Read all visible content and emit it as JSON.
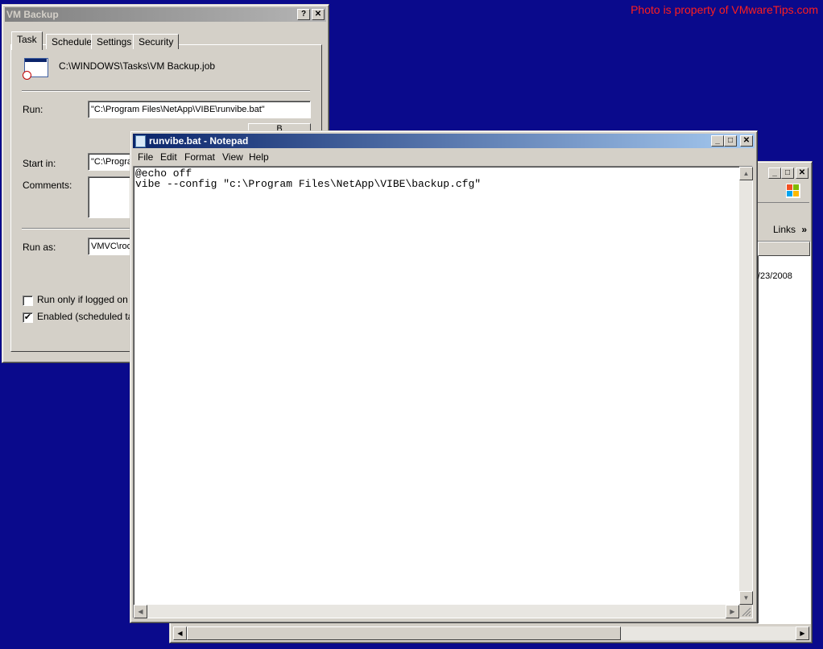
{
  "watermark": "Photo is property of VMwareTips.com",
  "vm_backup": {
    "title": "VM Backup",
    "help_btn": "?",
    "close_btn": "✕",
    "tabs": [
      "Task",
      "Schedule",
      "Settings",
      "Security"
    ],
    "job_path": "C:\\WINDOWS\\Tasks\\VM Backup.job",
    "run_label": "Run:",
    "run_value": "\"C:\\Program Files\\NetApp\\VIBE\\runvibe.bat\"",
    "start_in_label": "Start in:",
    "start_in_value": "\"C:\\Progra",
    "comments_label": "Comments:",
    "run_as_label": "Run as:",
    "run_as_value": "VMVC\\roo",
    "run_only_label": "Run only if logged on",
    "enabled_label": "Enabled (scheduled task",
    "browse_label": "B"
  },
  "notepad": {
    "title": "runvibe.bat - Notepad",
    "min_btn": "_",
    "max_btn": "□",
    "close_btn": "✕",
    "menu": [
      "File",
      "Edit",
      "Format",
      "View",
      "Help"
    ],
    "line1": "@echo off",
    "line2": "vibe --config \"c:\\Program Files\\NetApp\\VIBE\\backup.cfg\""
  },
  "explorer": {
    "links_label": "Links",
    "date_fragment": "/23/2008",
    "min_btn": "_",
    "max_btn": "□",
    "close_btn": "✕"
  }
}
